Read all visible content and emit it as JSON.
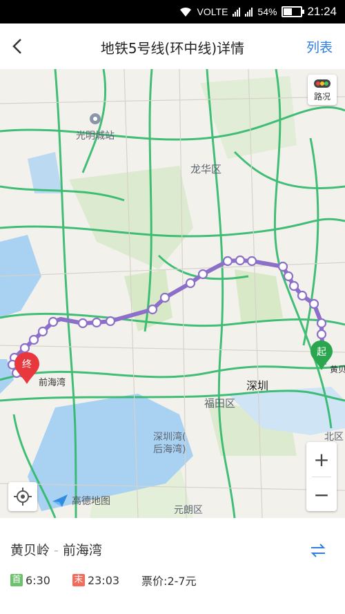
{
  "status_bar": {
    "network": "VOLTE",
    "battery": "54%",
    "battery_level": 0.54,
    "time": "21:24"
  },
  "header": {
    "title": "地铁5号线(环中线)详情",
    "list_label": "列表"
  },
  "map": {
    "traffic_label": "路况",
    "labels": {
      "guangming": "光明城站",
      "longhua": "龙华区",
      "qianhaiwan": "前海湾",
      "huangbei": "黄贝",
      "shenzhen": "深圳",
      "futian": "福田区",
      "shenzhenwan_1": "深圳湾(",
      "shenzhenwan_2": "后海湾)",
      "beiqu": "北区",
      "yuanlang": "元朗区"
    },
    "start_marker": "起",
    "end_marker": "终",
    "zoom_in": "+",
    "zoom_out": "−",
    "logo": "高德地图",
    "colors": {
      "route": "#8b6fc8",
      "roads": "#2fb86a",
      "start": "#2aa64e",
      "end": "#e8383d"
    }
  },
  "route_info": {
    "from": "黄贝岭",
    "separator": "-",
    "to": "前海湾",
    "first_tag": "首",
    "first_time": "6:30",
    "last_tag": "末",
    "last_time": "23:03",
    "fare": "票价:2-7元"
  }
}
